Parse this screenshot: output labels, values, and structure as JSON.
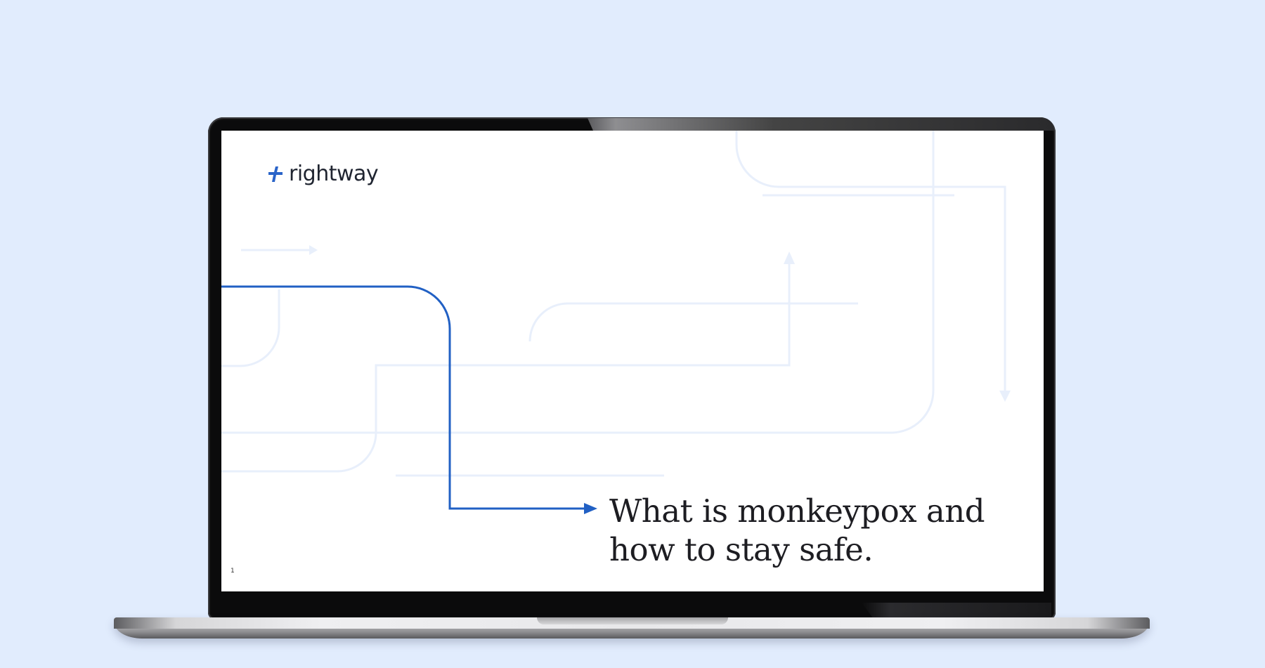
{
  "app": {
    "background_color": "#e1ecfd",
    "accent_color": "#1f5fc4"
  },
  "slide": {
    "logo": {
      "icon": "plus-mark-icon",
      "text": "rightway"
    },
    "headline_lines": [
      "What is monkeypox and",
      "how to stay safe."
    ],
    "slide_number": "1"
  }
}
